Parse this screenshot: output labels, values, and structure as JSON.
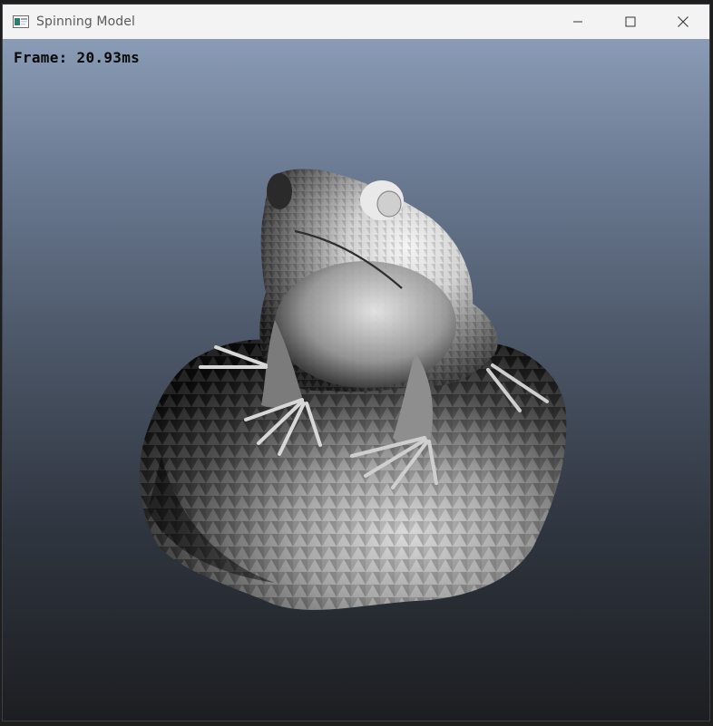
{
  "window": {
    "title": "Spinning Model",
    "icon": "app-window-icon"
  },
  "controls": {
    "minimize_icon": "minimize-icon",
    "maximize_icon": "maximize-icon",
    "close_icon": "close-icon"
  },
  "viewport": {
    "frame_label": "Frame: 20.93ms",
    "render_subject": "frame-on-lily-pad-model"
  },
  "colors": {
    "titlebar": "#f3f3f3",
    "sky_top": "#8a9bb5",
    "sky_bottom": "#1c1e21",
    "overlay_text": "#0a0a0a"
  }
}
